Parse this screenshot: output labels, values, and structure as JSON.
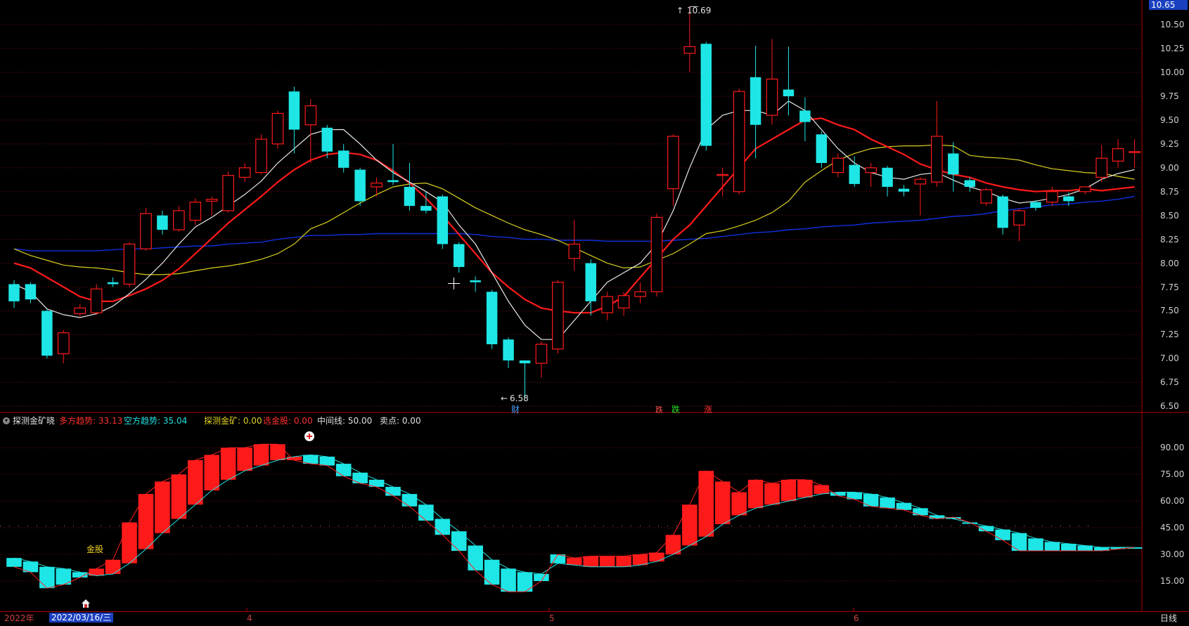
{
  "colors": {
    "background": "#000000",
    "up": "#ff1a1a",
    "down": "#1ee6e6",
    "ma5": "#e8e8e8",
    "ma10": "#ff1a1a",
    "ma20": "#d8d020",
    "ma60": "#1030e0",
    "grid": "#7a1010",
    "separator": "#b00000"
  },
  "header": {
    "price_tag": "10.65",
    "high_label": "10.69",
    "low_label": "6.58"
  },
  "markers": {
    "finance": "财",
    "fall1": "跌",
    "fall2": "跌",
    "rise": "涨"
  },
  "indicator": {
    "title": "探测金矿晓",
    "params": [
      {
        "text": "多方趋势: 33.13",
        "color": "#ff3030"
      },
      {
        "text": "空方趋势: 35.04",
        "color": "#20e0e0"
      },
      {
        "text": "探测金矿: 0.00",
        "color": "#e0d020"
      },
      {
        "text": "选金股: 0.00",
        "color": "#ff3030"
      },
      {
        "text": "中间线: 50.00",
        "color": "#e0e0e0"
      },
      {
        "text": "卖点: 0.00",
        "color": "#e0e0e0"
      }
    ],
    "gold_label": "金股"
  },
  "price_axis": [
    "10.50",
    "10.25",
    "10.00",
    "9.75",
    "9.50",
    "9.25",
    "9.00",
    "8.75",
    "8.50",
    "8.25",
    "8.00",
    "7.75",
    "7.50",
    "7.25",
    "7.00",
    "6.75",
    "6.50"
  ],
  "indicator_axis": [
    "90.00",
    "75.00",
    "60.00",
    "45.00",
    "30.00",
    "15.00"
  ],
  "date_bar": {
    "year": "2022年",
    "cursor_date": "2022/03/16/三",
    "months": [
      "4",
      "5",
      "6"
    ],
    "period_tab": "日线"
  },
  "chart_data": {
    "type": "candlestick",
    "ylim": [
      6.45,
      10.7
    ],
    "candles": [
      [
        7.78,
        7.6,
        7.82,
        7.53
      ],
      [
        7.78,
        7.62,
        7.8,
        7.58
      ],
      [
        7.5,
        7.03,
        7.52,
        7.0
      ],
      [
        7.05,
        7.27,
        7.3,
        6.95
      ],
      [
        7.47,
        7.53,
        7.57,
        7.44
      ],
      [
        7.48,
        7.73,
        7.78,
        7.46
      ],
      [
        7.8,
        7.78,
        7.85,
        7.75
      ],
      [
        7.78,
        8.2,
        8.22,
        7.75
      ],
      [
        8.15,
        8.52,
        8.58,
        8.13
      ],
      [
        8.5,
        8.35,
        8.55,
        8.3
      ],
      [
        8.35,
        8.55,
        8.6,
        8.33
      ],
      [
        8.45,
        8.64,
        8.68,
        8.4
      ],
      [
        8.65,
        8.67,
        8.7,
        8.5
      ],
      [
        8.55,
        8.92,
        8.96,
        8.53
      ],
      [
        8.9,
        9.0,
        9.05,
        8.85
      ],
      [
        8.95,
        9.3,
        9.35,
        8.93
      ],
      [
        9.25,
        9.57,
        9.6,
        9.2
      ],
      [
        9.8,
        9.4,
        9.85,
        9.15
      ],
      [
        9.45,
        9.65,
        9.72,
        9.05
      ],
      [
        9.42,
        9.17,
        9.45,
        9.1
      ],
      [
        9.18,
        9.0,
        9.25,
        8.95
      ],
      [
        8.98,
        8.65,
        9.0,
        8.6
      ],
      [
        8.8,
        8.84,
        8.9,
        8.7
      ],
      [
        8.87,
        8.85,
        9.25,
        8.82
      ],
      [
        8.8,
        8.6,
        9.05,
        8.55
      ],
      [
        8.6,
        8.55,
        8.75,
        8.52
      ],
      [
        8.7,
        8.2,
        8.72,
        8.15
      ],
      [
        8.2,
        7.96,
        8.22,
        7.9
      ],
      [
        7.82,
        7.8,
        7.86,
        7.7
      ],
      [
        7.7,
        7.15,
        7.72,
        7.1
      ],
      [
        7.2,
        6.98,
        7.22,
        6.9
      ],
      [
        6.98,
        6.95,
        6.98,
        6.58
      ],
      [
        6.95,
        7.15,
        7.18,
        6.8
      ],
      [
        7.1,
        7.8,
        7.82,
        7.05
      ],
      [
        8.05,
        8.2,
        8.45,
        7.92
      ],
      [
        8.0,
        7.6,
        8.04,
        7.45
      ],
      [
        7.48,
        7.65,
        7.7,
        7.4
      ],
      [
        7.53,
        7.66,
        7.7,
        7.45
      ],
      [
        7.65,
        7.7,
        7.8,
        7.58
      ],
      [
        7.7,
        8.48,
        8.52,
        7.65
      ],
      [
        8.78,
        9.33,
        9.35,
        8.6
      ],
      [
        10.2,
        10.27,
        10.69,
        10.0
      ],
      [
        10.3,
        9.23,
        10.32,
        9.18
      ],
      [
        8.92,
        8.93,
        9.0,
        8.7
      ],
      [
        8.75,
        9.8,
        9.83,
        8.72
      ],
      [
        9.95,
        9.45,
        10.28,
        9.1
      ],
      [
        9.55,
        9.93,
        10.35,
        9.45
      ],
      [
        9.82,
        9.75,
        10.27,
        9.55
      ],
      [
        9.6,
        9.48,
        9.74,
        9.28
      ],
      [
        9.35,
        9.05,
        9.38,
        9.0
      ],
      [
        8.95,
        9.1,
        9.15,
        8.9
      ],
      [
        9.03,
        8.83,
        9.12,
        8.8
      ],
      [
        8.95,
        9.0,
        9.05,
        8.8
      ],
      [
        9.0,
        8.8,
        9.02,
        8.7
      ],
      [
        8.78,
        8.75,
        8.82,
        8.7
      ],
      [
        8.83,
        8.88,
        8.9,
        8.5
      ],
      [
        8.85,
        9.33,
        9.7,
        8.8
      ],
      [
        9.15,
        8.93,
        9.27,
        8.75
      ],
      [
        8.87,
        8.8,
        8.9,
        8.75
      ],
      [
        8.63,
        8.77,
        8.79,
        8.6
      ],
      [
        8.7,
        8.37,
        8.72,
        8.3
      ],
      [
        8.4,
        8.55,
        8.57,
        8.23
      ],
      [
        8.64,
        8.58,
        8.66,
        8.55
      ],
      [
        8.64,
        8.75,
        8.8,
        8.6
      ],
      [
        8.7,
        8.65,
        8.74,
        8.6
      ],
      [
        8.75,
        8.8,
        8.8,
        8.72
      ],
      [
        8.9,
        9.1,
        9.24,
        8.85
      ],
      [
        9.07,
        9.2,
        9.3,
        9.0
      ],
      [
        9.17,
        9.17,
        9.3,
        9.0
      ]
    ],
    "ma5": [
      7.78,
      7.7,
      7.52,
      7.46,
      7.43,
      7.47,
      7.55,
      7.68,
      7.83,
      8.0,
      8.2,
      8.38,
      8.48,
      8.6,
      8.72,
      8.86,
      9.05,
      9.2,
      9.35,
      9.4,
      9.4,
      9.25,
      9.08,
      8.95,
      8.85,
      8.75,
      8.64,
      8.4,
      8.2,
      7.9,
      7.6,
      7.35,
      7.2,
      7.2,
      7.4,
      7.6,
      7.8,
      7.9,
      8.0,
      8.2,
      8.55,
      9.0,
      9.4,
      9.55,
      9.6,
      9.6,
      9.55,
      9.7,
      9.6,
      9.4,
      9.2,
      9.05,
      8.95,
      8.9,
      8.88,
      8.93,
      8.95,
      8.87,
      8.8,
      8.75,
      8.68,
      8.63,
      8.65,
      8.68,
      8.72,
      8.78,
      8.88,
      8.94,
      8.98
    ],
    "ma10": [
      8.0,
      7.95,
      7.85,
      7.75,
      7.65,
      7.6,
      7.6,
      7.66,
      7.73,
      7.82,
      7.94,
      8.1,
      8.26,
      8.42,
      8.56,
      8.7,
      8.85,
      8.98,
      9.08,
      9.14,
      9.16,
      9.14,
      9.08,
      8.97,
      8.84,
      8.68,
      8.5,
      8.3,
      8.1,
      7.9,
      7.75,
      7.62,
      7.53,
      7.5,
      7.48,
      7.48,
      7.55,
      7.65,
      7.85,
      8.05,
      8.25,
      8.4,
      8.6,
      8.8,
      9.0,
      9.2,
      9.3,
      9.4,
      9.5,
      9.52,
      9.45,
      9.4,
      9.3,
      9.22,
      9.14,
      9.04,
      8.98,
      8.93,
      8.9,
      8.84,
      8.8,
      8.77,
      8.75,
      8.76,
      8.76,
      8.78,
      8.76,
      8.78,
      8.8
    ],
    "ma20": [
      8.15,
      8.08,
      8.03,
      7.98,
      7.96,
      7.95,
      7.93,
      7.9,
      7.88,
      7.88,
      7.89,
      7.92,
      7.95,
      7.97,
      8.0,
      8.04,
      8.1,
      8.2,
      8.36,
      8.43,
      8.53,
      8.63,
      8.72,
      8.8,
      8.83,
      8.84,
      8.78,
      8.68,
      8.58,
      8.5,
      8.42,
      8.35,
      8.3,
      8.24,
      8.16,
      8.08,
      8.0,
      7.95,
      7.96,
      8.03,
      8.1,
      8.2,
      8.31,
      8.34,
      8.39,
      8.45,
      8.53,
      8.65,
      8.85,
      8.97,
      9.08,
      9.15,
      9.2,
      9.22,
      9.23,
      9.23,
      9.24,
      9.23,
      9.13,
      9.11,
      9.1,
      9.08,
      9.03,
      8.99,
      8.97,
      8.95,
      8.94,
      8.91,
      8.88
    ],
    "ma60": [
      8.15,
      8.13,
      8.13,
      8.13,
      8.13,
      8.13,
      8.14,
      8.15,
      8.15,
      8.16,
      8.17,
      8.18,
      8.18,
      8.2,
      8.21,
      8.22,
      8.25,
      8.27,
      8.29,
      8.29,
      8.3,
      8.3,
      8.31,
      8.31,
      8.31,
      8.31,
      8.31,
      8.31,
      8.3,
      8.28,
      8.27,
      8.25,
      8.25,
      8.24,
      8.24,
      8.24,
      8.23,
      8.23,
      8.23,
      8.23,
      8.24,
      8.25,
      8.26,
      8.28,
      8.3,
      8.32,
      8.33,
      8.35,
      8.36,
      8.38,
      8.39,
      8.4,
      8.42,
      8.43,
      8.44,
      8.45,
      8.47,
      8.49,
      8.5,
      8.52,
      8.55,
      8.57,
      8.59,
      8.61,
      8.62,
      8.64,
      8.65,
      8.67,
      8.7
    ],
    "indicator": {
      "ylim": [
        0,
        100
      ],
      "bars": [
        [
          28,
          23,
          0
        ],
        [
          26,
          20,
          0
        ],
        [
          23,
          11,
          0
        ],
        [
          22,
          13,
          0
        ],
        [
          20,
          17,
          0
        ],
        [
          18,
          22,
          1
        ],
        [
          19,
          27,
          1
        ],
        [
          25,
          48,
          1
        ],
        [
          33,
          64,
          1
        ],
        [
          42,
          71,
          1
        ],
        [
          50,
          75,
          1
        ],
        [
          58,
          83,
          1
        ],
        [
          66,
          86,
          1
        ],
        [
          72,
          90,
          1
        ],
        [
          77,
          90,
          1
        ],
        [
          80,
          92,
          1
        ],
        [
          83,
          92,
          1
        ],
        [
          85,
          83,
          1
        ],
        [
          86,
          81,
          0
        ],
        [
          85,
          80,
          0
        ],
        [
          81,
          74,
          0
        ],
        [
          76,
          70,
          0
        ],
        [
          72,
          68,
          0
        ],
        [
          68,
          63,
          0
        ],
        [
          64,
          57,
          0
        ],
        [
          58,
          49,
          0
        ],
        [
          50,
          41,
          0
        ],
        [
          43,
          32,
          0
        ],
        [
          35,
          21,
          0
        ],
        [
          27,
          13,
          0
        ],
        [
          22,
          9,
          0
        ],
        [
          20,
          9,
          0
        ],
        [
          19,
          15,
          0
        ],
        [
          25,
          30,
          0
        ],
        [
          24,
          28,
          1
        ],
        [
          23,
          29,
          1
        ],
        [
          23,
          29,
          1
        ],
        [
          23,
          29,
          1
        ],
        [
          24,
          30,
          1
        ],
        [
          26,
          31,
          1
        ],
        [
          30,
          41,
          1
        ],
        [
          35,
          58,
          1
        ],
        [
          40,
          77,
          1
        ],
        [
          47,
          71,
          1
        ],
        [
          52,
          65,
          1
        ],
        [
          56,
          72,
          1
        ],
        [
          58,
          70,
          1
        ],
        [
          60,
          72,
          1
        ],
        [
          62,
          72,
          1
        ],
        [
          64,
          69,
          1
        ],
        [
          65,
          63,
          0
        ],
        [
          65,
          61,
          0
        ],
        [
          64,
          57,
          0
        ],
        [
          62,
          56,
          0
        ],
        [
          59,
          55,
          0
        ],
        [
          56,
          52,
          0
        ],
        [
          52,
          50,
          0
        ],
        [
          50,
          51,
          0
        ],
        [
          48,
          48,
          0
        ],
        [
          46,
          43,
          0
        ],
        [
          44,
          38,
          0
        ],
        [
          42,
          32,
          0
        ],
        [
          39,
          32,
          0
        ],
        [
          37,
          32,
          0
        ],
        [
          36,
          32,
          0
        ],
        [
          35,
          32,
          0
        ],
        [
          34,
          32,
          0
        ],
        [
          34,
          33,
          0
        ],
        [
          34,
          34,
          0
        ]
      ]
    }
  }
}
